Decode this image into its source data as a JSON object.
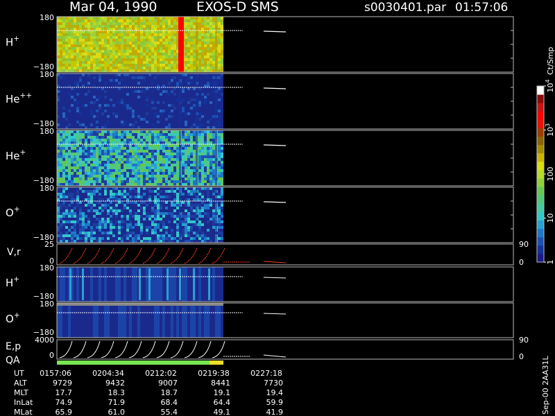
{
  "header": {
    "date": "Mar 04, 1990",
    "instrument": "EXOS-D SMS",
    "file": "s0030401.par",
    "time": "01:57:06"
  },
  "colorbar": {
    "unit": "Ct/Smp",
    "ticks": [
      {
        "value": 1,
        "label": "1"
      },
      {
        "value": 10,
        "label": "10"
      },
      {
        "value": 100,
        "label": "100"
      },
      {
        "value": 1000,
        "label": "10"
      },
      {
        "value": 10000,
        "label": "10"
      }
    ],
    "sup": [
      "",
      "",
      "",
      "3",
      "4"
    ],
    "colors": [
      "#1a1a8c",
      "#14329c",
      "#1e50b4",
      "#1e78c8",
      "#28a0d2",
      "#32c8c8",
      "#46c8a0",
      "#50c878",
      "#64c850",
      "#8cd23c",
      "#b4dc28",
      "#dcdc14",
      "#c8b400",
      "#a08c00",
      "#8c6400",
      "#a03c00",
      "#e61400",
      "#ff0000",
      "#c81414",
      "#8c0a0a",
      "#ffffff"
    ]
  },
  "panels": [
    {
      "id": "h-plus",
      "label": "H",
      "sup": "+",
      "ymax": "180",
      "ymin": "−180"
    },
    {
      "id": "he-plusplus",
      "label": "He",
      "sup": "++",
      "ymax": "180",
      "ymin": "−180"
    },
    {
      "id": "he-plus",
      "label": "He",
      "sup": "+",
      "ymax": "180",
      "ymin": "−180"
    },
    {
      "id": "o-plus",
      "label": "O",
      "sup": "+",
      "ymax": "180",
      "ymin": "−180"
    }
  ],
  "vr_panel": {
    "label": "V,r",
    "ymax": "25",
    "ymid": "0",
    "right_top": "90",
    "right_bottom": "0"
  },
  "lower_panels": [
    {
      "id": "h-plus-2",
      "label": "H",
      "sup": "+",
      "ymax": "180",
      "ymin": "−180"
    },
    {
      "id": "o-plus-2",
      "label": "O",
      "sup": "+",
      "ymax": "180",
      "ymin": "−180"
    }
  ],
  "ep_panel": {
    "label": "E,p",
    "label2": "QA",
    "ymax": "4000",
    "ymid": "0",
    "right_top": "90",
    "right_bottom": "0"
  },
  "footer": {
    "rows": [
      {
        "name": "UT",
        "values": [
          "0157:06",
          "0204:34",
          "0212:02",
          "0219:38",
          "0227:18"
        ]
      },
      {
        "name": "ALT",
        "values": [
          "9729",
          "9432",
          "9007",
          "8441",
          "7730"
        ]
      },
      {
        "name": "MLT",
        "values": [
          "17.7",
          "18.3",
          "18.7",
          "19.1",
          "19.4"
        ]
      },
      {
        "name": "InLat",
        "values": [
          "74.9",
          "71.9",
          "68.4",
          "64.4",
          "59.9"
        ]
      },
      {
        "name": "MLat",
        "values": [
          "65.9",
          "61.0",
          "55.4",
          "49.1",
          "41.9"
        ]
      }
    ],
    "side_note": "Sep-00  2AA31L"
  },
  "chart_data": {
    "type": "heatmap",
    "title": "Mar 04, 1990   EXOS-D SMS",
    "x_time_ticks": [
      "0157:06",
      "0204:34",
      "0212:02",
      "0219:38",
      "0227:18"
    ],
    "panels": [
      "H+",
      "He++",
      "He+",
      "O+",
      "V,r",
      "H+",
      "O+",
      "E,p"
    ],
    "pitch_angle_range": [
      -180,
      180
    ],
    "vr_range": [
      0,
      25
    ],
    "energy_range": [
      0,
      4000
    ],
    "colorbar_range": [
      1,
      10000
    ],
    "colorbar_scale": "log",
    "grid": false
  }
}
